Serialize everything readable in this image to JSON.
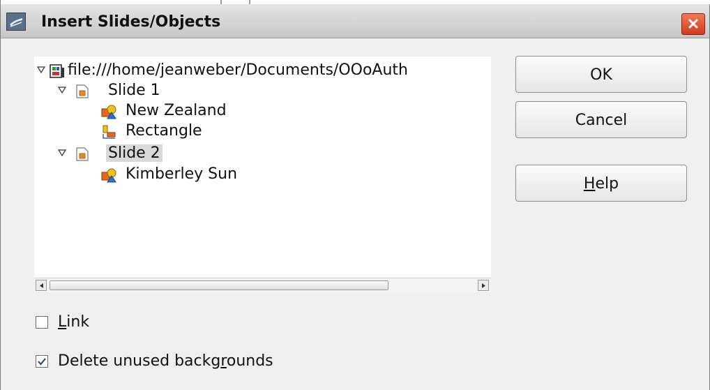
{
  "window": {
    "title": "Insert Slides/Objects"
  },
  "tree": {
    "root": {
      "label": "file:///home/jeanweber/Documents/OOoAuth",
      "icon": "document-file-icon"
    },
    "slides": [
      {
        "label": "Slide 1",
        "icon": "slide-icon",
        "objects": [
          {
            "label": "New Zealand",
            "icon": "shapes-object-icon"
          },
          {
            "label": "Rectangle",
            "icon": "rectangle-object-icon"
          }
        ]
      },
      {
        "label": "Slide 2",
        "icon": "slide-icon",
        "selected": true,
        "objects": [
          {
            "label": "Kimberley Sun",
            "icon": "shapes-object-icon"
          }
        ]
      }
    ]
  },
  "buttons": {
    "ok": "OK",
    "cancel": "Cancel",
    "help": {
      "mnemonic": "H",
      "rest": "elp"
    }
  },
  "options": {
    "link": {
      "mnemonic": "L",
      "rest": "ink",
      "checked": false
    },
    "delete_unused": {
      "before": "Delete unused backg",
      "mnemonic": "r",
      "after": "ounds",
      "checked": true
    }
  },
  "colors": {
    "close_button": "#d23a1d",
    "selection": "#d9d9d9"
  }
}
